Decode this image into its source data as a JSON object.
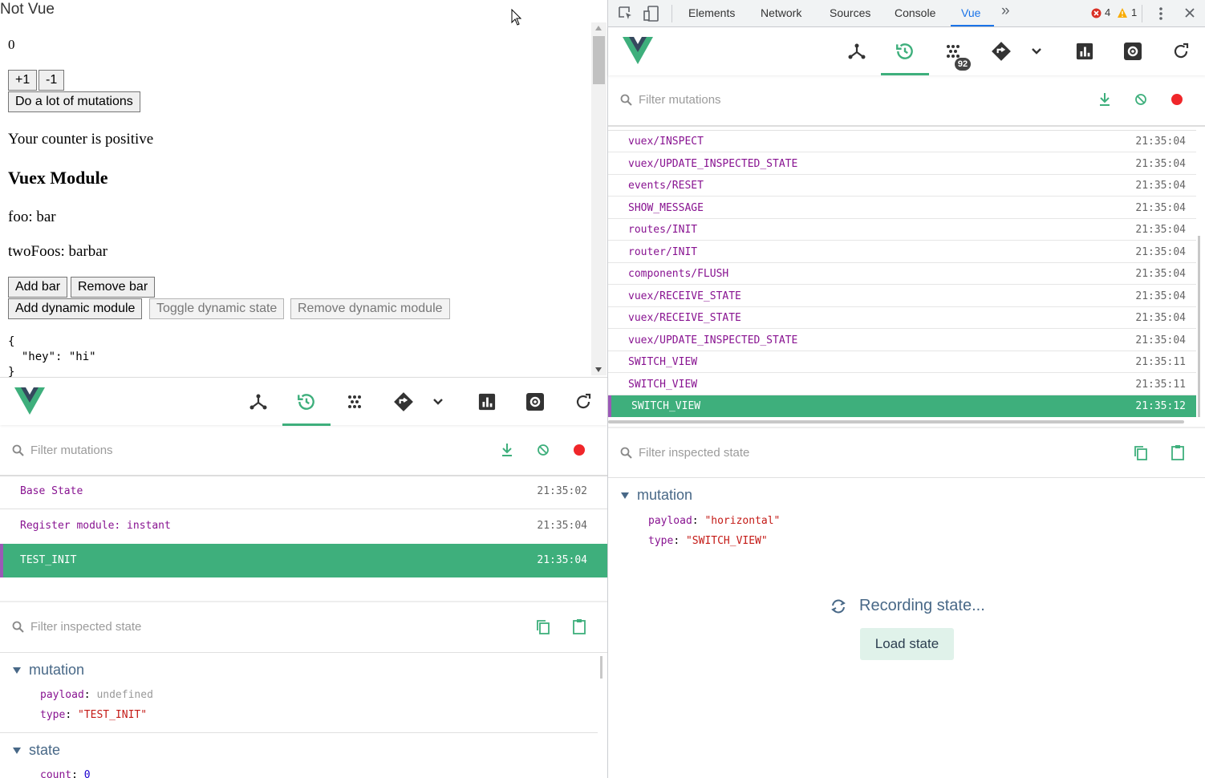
{
  "page": {
    "title": "Not Vue",
    "counter": "0",
    "inc_label": "+1",
    "dec_label": "-1",
    "mutations_label": "Do a lot of mutations",
    "counter_text": "Your counter is positive",
    "vuex_heading": "Vuex Module",
    "foo_text": "foo: bar",
    "twofoos_text": "twoFoos: barbar",
    "add_bar": "Add bar",
    "remove_bar": "Remove bar",
    "add_dynamic": "Add dynamic module",
    "toggle_dynamic": "Toggle dynamic state",
    "remove_dynamic": "Remove dynamic module",
    "json_text": "{\n  \"hey\": \"hi\"\n}"
  },
  "left_devtools": {
    "filter_placeholder": "Filter mutations",
    "mutations": [
      {
        "name": "Base State",
        "time": "21:35:02"
      },
      {
        "name": "Register module: instant",
        "time": "21:35:04"
      },
      {
        "name": "TEST_INIT",
        "time": "21:35:04"
      }
    ],
    "inspect_placeholder": "Filter inspected state",
    "mutation_section": "mutation",
    "payload_key": "payload",
    "payload_value": "undefined",
    "type_key": "type",
    "type_value": "\"TEST_INIT\"",
    "state_section": "state",
    "count_key": "count",
    "count_value": "0"
  },
  "chrome": {
    "tabs": [
      "Elements",
      "Network",
      "Sources",
      "Console",
      "Vue"
    ],
    "more": "»",
    "errors": "4",
    "warnings": "1"
  },
  "right_devtools": {
    "perf_badge": "92",
    "filter_placeholder": "Filter mutations",
    "mutations": [
      {
        "name": "vuex/INSPECT",
        "time": "21:35:04"
      },
      {
        "name": "vuex/UPDATE_INSPECTED_STATE",
        "time": "21:35:04"
      },
      {
        "name": "events/RESET",
        "time": "21:35:04"
      },
      {
        "name": "SHOW_MESSAGE",
        "time": "21:35:04"
      },
      {
        "name": "routes/INIT",
        "time": "21:35:04"
      },
      {
        "name": "router/INIT",
        "time": "21:35:04"
      },
      {
        "name": "components/FLUSH",
        "time": "21:35:04"
      },
      {
        "name": "vuex/RECEIVE_STATE",
        "time": "21:35:04"
      },
      {
        "name": "vuex/RECEIVE_STATE",
        "time": "21:35:04"
      },
      {
        "name": "vuex/UPDATE_INSPECTED_STATE",
        "time": "21:35:04"
      },
      {
        "name": "SWITCH_VIEW",
        "time": "21:35:11"
      },
      {
        "name": "SWITCH_VIEW",
        "time": "21:35:11"
      },
      {
        "name": "SWITCH_VIEW",
        "time": "21:35:12"
      }
    ],
    "inspect_placeholder": "Filter inspected state",
    "mutation_section": "mutation",
    "payload_key": "payload",
    "payload_value": "\"horizontal\"",
    "type_key": "type",
    "type_value": "\"SWITCH_VIEW\"",
    "recording_text": "Recording state...",
    "load_state": "Load state"
  },
  "colors": {
    "accent": "#3eaf7c",
    "mutation_text": "#881391",
    "string_value": "#c41a16",
    "selected_edge": "#9b59b6"
  }
}
